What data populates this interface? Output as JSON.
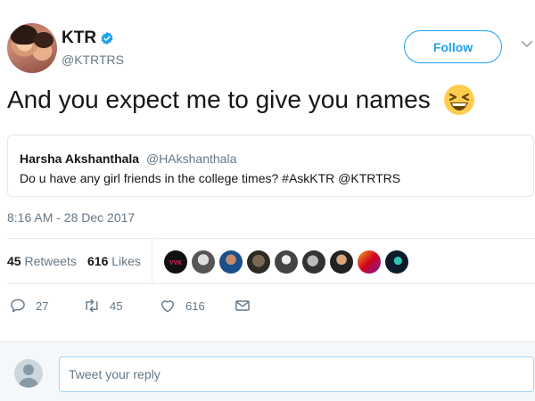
{
  "author": {
    "display_name": "KTR",
    "handle": "@KTRTRS",
    "verified": true,
    "follow_label": "Follow"
  },
  "tweet": {
    "text": "And you expect me to give you names",
    "emoji": "grinning-squinting-face-icon",
    "timestamp": "8:16 AM - 28 Dec 2017"
  },
  "quoted_tweet": {
    "name": "Harsha Akshanthala",
    "handle": "@HAkshanthala",
    "text": "Do u have any girl friends in the college times? #AskKTR @KTRTRS"
  },
  "stats": {
    "retweets_count": "45",
    "retweets_label": "Retweets",
    "likes_count": "616",
    "likes_label": "Likes",
    "liker_avatar_count": 9
  },
  "actions": {
    "reply_count": "27",
    "retweet_count": "45",
    "like_count": "616"
  },
  "reply": {
    "placeholder": "Tweet your reply"
  },
  "colors": {
    "accent": "#1da1f2",
    "secondary_text": "#657786",
    "primary_text": "#14171a",
    "border": "#e6ecf0"
  }
}
